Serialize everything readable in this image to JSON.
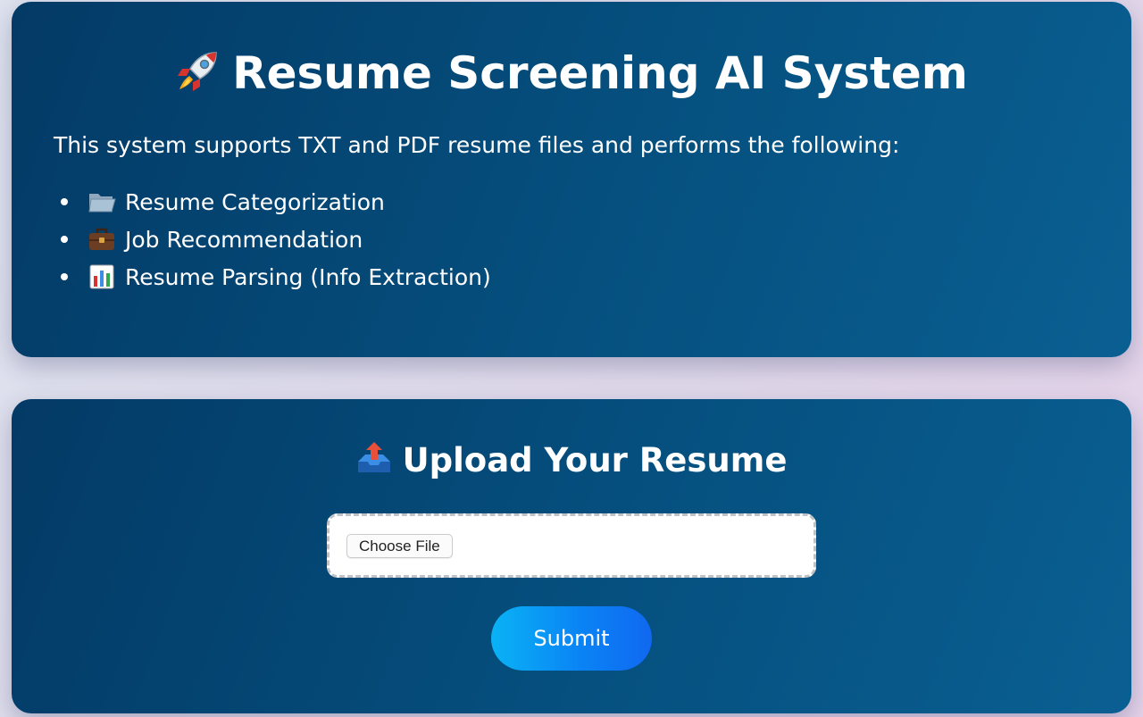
{
  "intro": {
    "title": "Resume Screening AI System",
    "title_icon": "rocket-icon",
    "description": "This system supports TXT and PDF resume files and performs the following:",
    "features": [
      {
        "label": "Resume Categorization",
        "icon": "folder-icon"
      },
      {
        "label": "Job Recommendation",
        "icon": "briefcase-icon"
      },
      {
        "label": "Resume Parsing (Info Extraction)",
        "icon": "bar-chart-icon"
      }
    ]
  },
  "upload": {
    "title": "Upload Your Resume",
    "title_icon": "outbox-tray-icon",
    "choose_file_label": "Choose File",
    "submit_label": "Submit"
  },
  "colors": {
    "card_background": "#05507f",
    "submit_gradient_start": "#0ab3f5",
    "submit_gradient_end": "#1068f0",
    "text": "#ffffff"
  }
}
